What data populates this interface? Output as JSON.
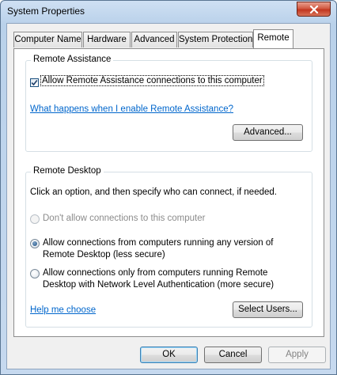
{
  "window": {
    "title": "System Properties"
  },
  "tabs": [
    {
      "label": "Computer Name",
      "active": false
    },
    {
      "label": "Hardware",
      "active": false
    },
    {
      "label": "Advanced",
      "active": false
    },
    {
      "label": "System Protection",
      "active": false
    },
    {
      "label": "Remote",
      "active": true
    }
  ],
  "remote_assistance": {
    "legend": "Remote Assistance",
    "allow_checkbox": {
      "label": "Allow Remote Assistance connections to this computer",
      "checked": true
    },
    "help_link": "What happens when I enable Remote Assistance?",
    "advanced_button": "Advanced..."
  },
  "remote_desktop": {
    "legend": "Remote Desktop",
    "instruction": "Click an option, and then specify who can connect, if needed.",
    "options": [
      {
        "lines": [
          "Don't allow connections to this computer"
        ],
        "selected": false,
        "enabled": false
      },
      {
        "lines": [
          "Allow connections from computers running any version of",
          "Remote Desktop (less secure)"
        ],
        "selected": true,
        "enabled": true
      },
      {
        "lines": [
          "Allow connections only from computers running Remote",
          "Desktop with Network Level Authentication (more secure)"
        ],
        "selected": false,
        "enabled": true
      }
    ],
    "help_link": "Help me choose",
    "select_users_button": "Select Users..."
  },
  "dialog_buttons": {
    "ok": "OK",
    "cancel": "Cancel",
    "apply": "Apply"
  },
  "icons": {
    "close": "close-icon",
    "checkmark": "checkmark-icon"
  }
}
